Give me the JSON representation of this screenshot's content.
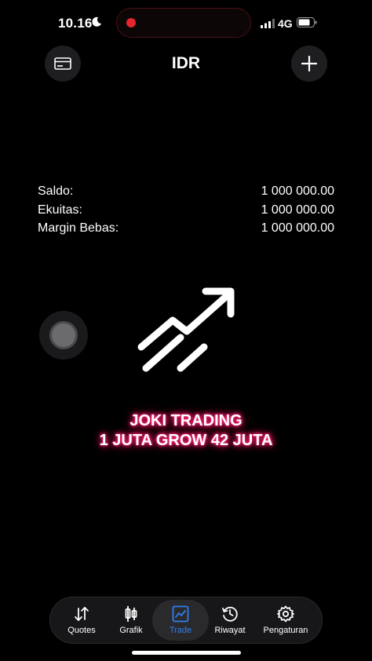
{
  "status_bar": {
    "time": "10.16",
    "network": "4G"
  },
  "header": {
    "title": "IDR"
  },
  "account": {
    "rows": [
      {
        "label": "Saldo:",
        "value": "1 000 000.00"
      },
      {
        "label": "Ekuitas:",
        "value": "1 000 000.00"
      },
      {
        "label": "Margin Bebas:",
        "value": "1 000 000.00"
      }
    ]
  },
  "promo": {
    "line1": "JOKI TRADING",
    "line2": "1 JUTA GROW 42 JUTA"
  },
  "tabs": [
    {
      "label": "Quotes",
      "icon": "arrows-updown-icon"
    },
    {
      "label": "Grafik",
      "icon": "candlestick-icon"
    },
    {
      "label": "Trade",
      "icon": "trade-chart-icon"
    },
    {
      "label": "Riwayat",
      "icon": "history-icon"
    },
    {
      "label": "Pengaturan",
      "icon": "gear-icon"
    }
  ],
  "colors": {
    "background": "#000000",
    "accent": "#2d7ff0",
    "promo_glow": "#ff2a7a",
    "recording": "#e5262b"
  }
}
